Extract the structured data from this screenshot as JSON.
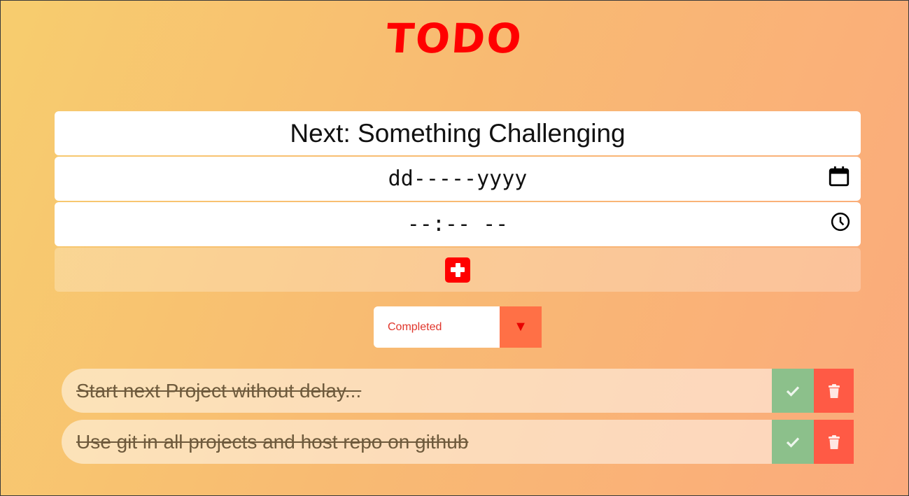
{
  "app": {
    "title": "TODO"
  },
  "form": {
    "task_value": "Next: Something Challenging",
    "date_placeholder": "dd-----yyyy",
    "time_placeholder": "--:-- --",
    "date_icon": "calendar-icon",
    "time_icon": "clock-icon",
    "add_icon": "plus-square-icon"
  },
  "filter": {
    "selected": "Completed",
    "arrow": "▼"
  },
  "todos": [
    {
      "text": "Start next Project without delay...",
      "completed": true
    },
    {
      "text": "Use git in all projects and host repo on github",
      "completed": true
    }
  ],
  "colors": {
    "accent": "#ff0000",
    "complete_button": "#8cc08b",
    "delete_button": "#ff5a45",
    "filter_arrow_bg": "#ff7046"
  }
}
